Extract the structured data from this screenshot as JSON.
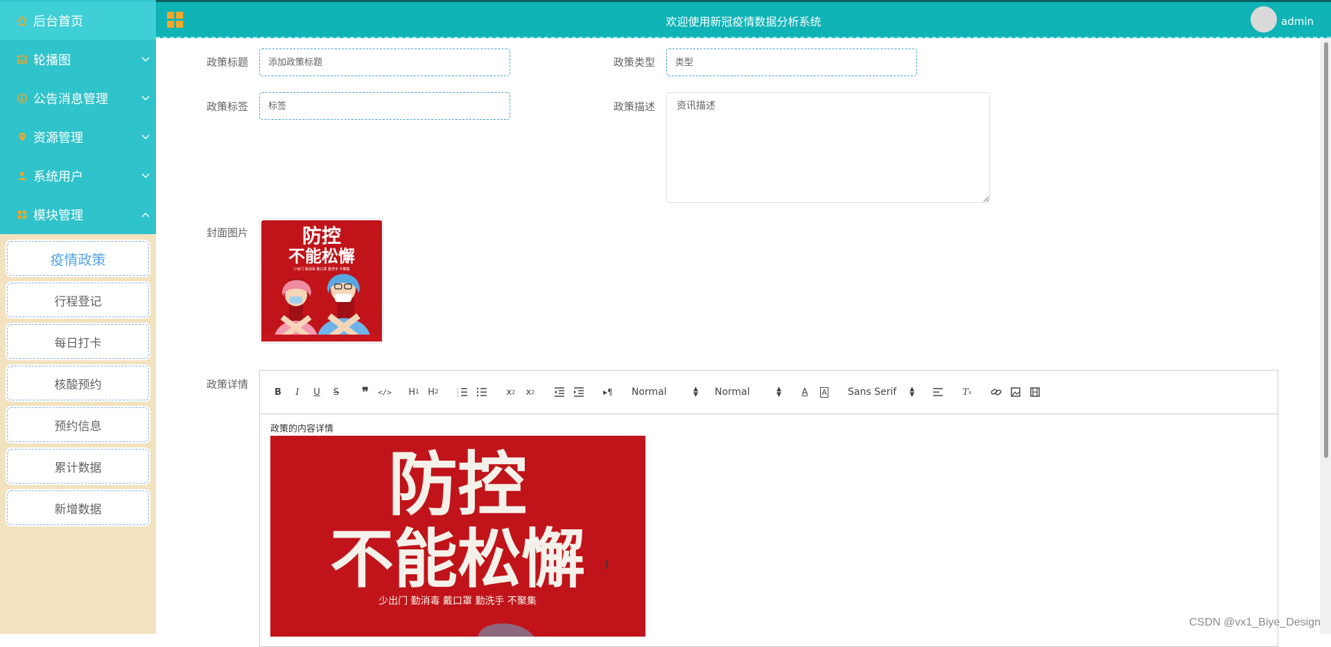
{
  "sidebar": {
    "menu": [
      {
        "label": "后台首页",
        "icon": "home-icon",
        "chevron": ""
      },
      {
        "label": "轮播图",
        "icon": "image-icon",
        "chevron": "down"
      },
      {
        "label": "公告消息管理",
        "icon": "info-icon",
        "chevron": "down"
      },
      {
        "label": "资源管理",
        "icon": "location-icon",
        "chevron": "down"
      },
      {
        "label": "系统用户",
        "icon": "user-icon",
        "chevron": "down"
      },
      {
        "label": "模块管理",
        "icon": "module-icon",
        "chevron": "up"
      }
    ],
    "submenu": [
      "疫情政策",
      "行程登记",
      "每日打卡",
      "核酸预约",
      "预约信息",
      "累计数据",
      "新增数据"
    ],
    "active_submenu": "疫情政策"
  },
  "header": {
    "title": "欢迎使用新冠疫情数据分析系统",
    "username": "admin"
  },
  "form": {
    "title_label": "政策标题",
    "title_placeholder": "添加政策标题",
    "type_label": "政策类型",
    "type_placeholder": "类型",
    "tag_label": "政策标签",
    "tag_placeholder": "标签",
    "desc_label": "政策描述",
    "desc_placeholder": "资讯描述",
    "cover_label": "封面图片",
    "detail_label": "政策详情"
  },
  "poster": {
    "line1": "防控",
    "line2": "不能松懈",
    "slogan": "少出门  勤消毒  戴口罩  勤洗手  不聚集"
  },
  "editor": {
    "toolbar": {
      "header_picker": "Normal",
      "size_picker": "Normal",
      "font_picker": "Sans Serif"
    },
    "content_text": "政策的内容详情"
  },
  "watermark": "CSDN @vx1_Biye_Design",
  "colors": {
    "sidebar_menu": "#2fc3cb",
    "sidebar_bg": "#f3e2c0",
    "header": "#0fb3b6",
    "accent": "#f5a623",
    "poster_red": "#c8161d"
  }
}
